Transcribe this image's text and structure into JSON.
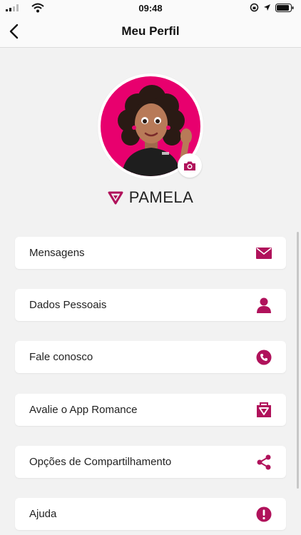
{
  "status_bar": {
    "time": "09:48"
  },
  "nav": {
    "title": "Meu Perfil"
  },
  "profile": {
    "name": "PAMELA"
  },
  "menu": {
    "items": [
      {
        "label": "Mensagens",
        "icon": "envelope-icon"
      },
      {
        "label": "Dados Pessoais",
        "icon": "person-icon"
      },
      {
        "label": "Fale conosco",
        "icon": "phone-icon"
      },
      {
        "label": "Avalie o App Romance",
        "icon": "romance-bag-icon"
      },
      {
        "label": "Opções de Compartilhamento",
        "icon": "share-icon"
      },
      {
        "label": "Ajuda",
        "icon": "exclamation-icon"
      }
    ]
  },
  "colors": {
    "accent": "#b0125b",
    "avatar_bg": "#e8006e",
    "background": "#f2f2f2"
  }
}
